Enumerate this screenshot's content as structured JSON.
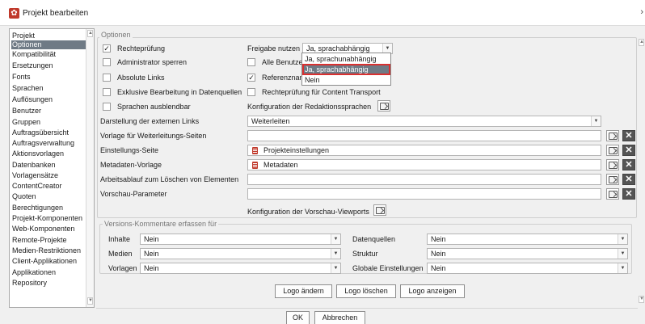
{
  "window": {
    "title": "Projekt bearbeiten"
  },
  "nav": {
    "items": [
      "Projekt",
      "Optionen",
      "Kompatibilität",
      "Ersetzungen",
      "Fonts",
      "Sprachen",
      "Auflösungen",
      "Benutzer",
      "Gruppen",
      "Auftragsübersicht",
      "Auftragsverwaltung",
      "Aktionsvorlagen",
      "Datenbanken",
      "Vorlagensätze",
      "ContentCreator",
      "Quoten",
      "Berechtigungen",
      "Projekt-Komponenten",
      "Web-Komponenten",
      "Remote-Projekte",
      "Medien-Restriktionen",
      "Client-Applikationen",
      "Applikationen",
      "Repository"
    ],
    "selected": "Optionen"
  },
  "optionen": {
    "legend": "Optionen",
    "rechtepruefung": {
      "label": "Rechteprüfung",
      "checked": true
    },
    "admin_sperren": {
      "label": "Administrator sperren",
      "checked": false
    },
    "absolute_links": {
      "label": "Absolute Links",
      "checked": false
    },
    "exklusive_bearbeitung": {
      "label": "Exklusive Bearbeitung in Datenquellen",
      "checked": false
    },
    "sprachen_ausblendbar": {
      "label": "Sprachen ausblendbar",
      "checked": false
    },
    "freigabe_label": "Freigabe nutzen",
    "freigabe_value": "Ja, sprachabhängig",
    "freigabe_options": [
      "Ja, sprachunabhängig",
      "Ja, sprachabhängig",
      "Nein"
    ],
    "alle_benutzer": {
      "label": "Alle Benutzer",
      "checked": false
    },
    "referenznamen": {
      "label": "Referenznam",
      "checked": true
    },
    "rechtepruefung_ct": {
      "label": "Rechteprüfung für Content Transport",
      "checked": false
    },
    "konfig_redaktionssprachen": "Konfiguration der Redaktionssprachen",
    "externe_links_label": "Darstellung der externen Links",
    "externe_links_value": "Weiterleiten",
    "weiterleitung_label": "Vorlage für Weiterleitungs-Seiten",
    "einstellungs_label": "Einstellungs-Seite",
    "einstellungs_value": "Projekteinstellungen",
    "metadaten_label": "Metadaten-Vorlage",
    "metadaten_value": "Metadaten",
    "arbeitsablauf_label": "Arbeitsablauf zum Löschen von Elementen",
    "vorschau_label": "Vorschau-Parameter",
    "konfig_viewports": "Konfiguration der Vorschau-Viewports",
    "delete_glyph": "✕"
  },
  "versions": {
    "legend": "Versions-Kommentare erfassen für",
    "inhalte": {
      "label": "Inhalte",
      "value": "Nein"
    },
    "medien": {
      "label": "Medien",
      "value": "Nein"
    },
    "vorlagen": {
      "label": "Vorlagen",
      "value": "Nein"
    },
    "datenquellen": {
      "label": "Datenquellen",
      "value": "Nein"
    },
    "struktur": {
      "label": "Struktur",
      "value": "Nein"
    },
    "globale": {
      "label": "Globale Einstellungen",
      "value": "Nein"
    }
  },
  "logo_buttons": {
    "aendern": "Logo ändern",
    "loeschen": "Logo löschen",
    "anzeigen": "Logo anzeigen"
  },
  "dialog_buttons": {
    "ok": "OK",
    "abbrechen": "Abbrechen"
  },
  "glyphs": {
    "check": "✓",
    "dd_arrow": "▼",
    "up": "▲",
    "down": "▼",
    "chevron": "›"
  },
  "colors": {
    "selection": "#6f7a85",
    "highlight_outline": "#d93030",
    "app_icon": "#c0392b"
  }
}
